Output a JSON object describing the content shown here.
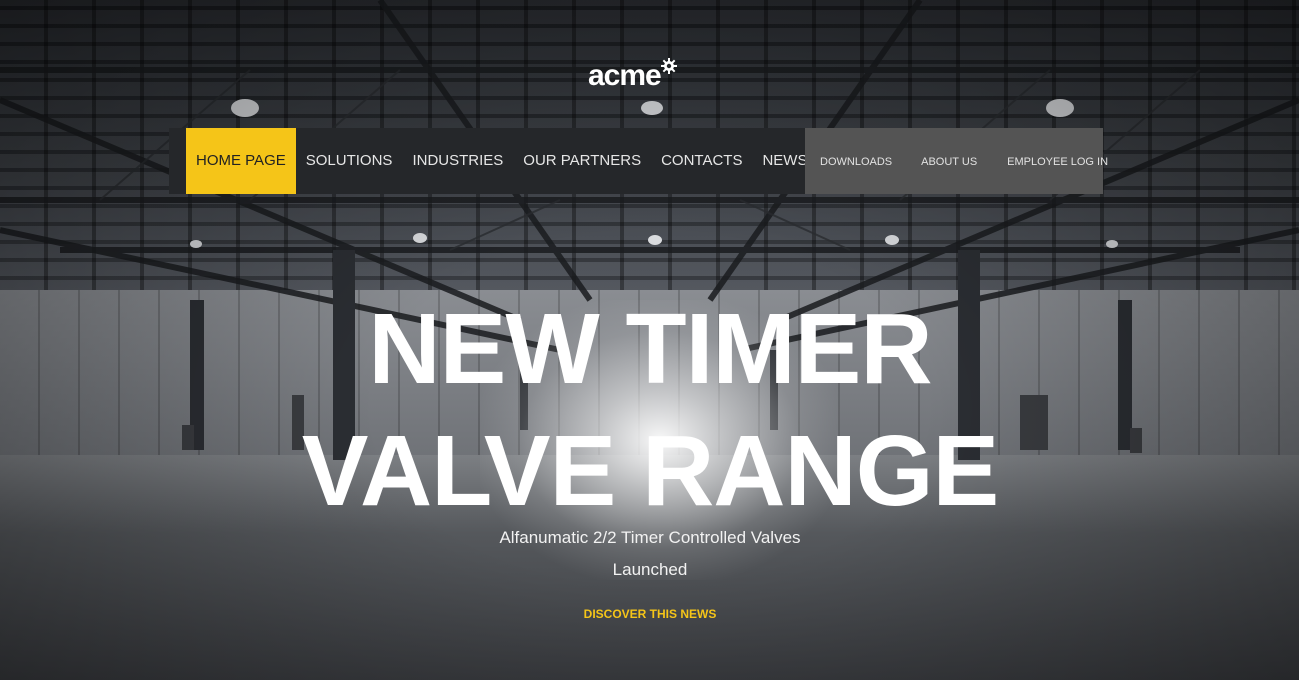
{
  "logo": {
    "text": "acme"
  },
  "nav": {
    "main_items": [
      {
        "label": "HOME PAGE",
        "active": true
      },
      {
        "label": "SOLUTIONS",
        "active": false
      },
      {
        "label": "INDUSTRIES",
        "active": false
      },
      {
        "label": "OUR PARTNERS",
        "active": false
      },
      {
        "label": "CONTACTS",
        "active": false
      },
      {
        "label": "NEWS",
        "active": false
      }
    ],
    "search_icon": "search-icon",
    "secondary_items": [
      {
        "label": "DOWNLOADS"
      },
      {
        "label": "ABOUT US"
      },
      {
        "label": "EMPLOYEE LOG IN"
      }
    ]
  },
  "hero": {
    "title_line1": "NEW TIMER",
    "title_line2": "VALVE RANGE",
    "subtitle_line1": "Alfanumatic 2/2 Timer Controlled Valves",
    "subtitle_line2": "Launched",
    "cta": "DISCOVER THIS NEWS"
  },
  "colors": {
    "accent": "#f5c518",
    "nav_main_bg": "#25272a",
    "nav_secondary_bg": "#545454",
    "text_light": "#ffffff"
  }
}
